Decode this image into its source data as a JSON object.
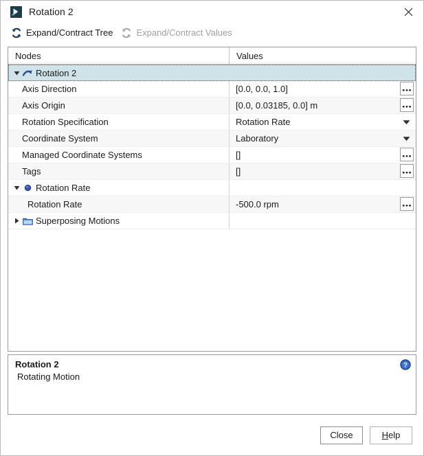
{
  "window": {
    "title": "Rotation 2",
    "icon": "rotation-app-icon",
    "close_icon": "close-icon"
  },
  "toolbar": {
    "items": [
      {
        "label": "Expand/Contract Tree",
        "icon": "refresh-icon",
        "enabled": true
      },
      {
        "label": "Expand/Contract Values",
        "icon": "refresh-icon",
        "enabled": false
      }
    ]
  },
  "table": {
    "columns": [
      "Nodes",
      "Values"
    ],
    "rows": [
      {
        "label": "Rotation 2",
        "value": "",
        "indent": 0,
        "twisty": "expanded",
        "icon": "rotation-arrow-icon",
        "selected": true,
        "shade": false,
        "control": "none"
      },
      {
        "label": "Axis Direction",
        "value": "[0.0, 0.0, 1.0]",
        "indent": 1,
        "twisty": "none",
        "icon": "none",
        "selected": false,
        "shade": false,
        "control": "ellipsis"
      },
      {
        "label": "Axis Origin",
        "value": "[0.0, 0.03185, 0.0] m",
        "indent": 1,
        "twisty": "none",
        "icon": "none",
        "selected": false,
        "shade": true,
        "control": "ellipsis"
      },
      {
        "label": "Rotation Specification",
        "value": "Rotation Rate",
        "indent": 1,
        "twisty": "none",
        "icon": "none",
        "selected": false,
        "shade": false,
        "control": "dropdown"
      },
      {
        "label": "Coordinate System",
        "value": "Laboratory",
        "indent": 1,
        "twisty": "none",
        "icon": "none",
        "selected": false,
        "shade": true,
        "control": "dropdown"
      },
      {
        "label": "Managed Coordinate Systems",
        "value": "[]",
        "indent": 1,
        "twisty": "none",
        "icon": "none",
        "selected": false,
        "shade": false,
        "control": "ellipsis"
      },
      {
        "label": "Tags",
        "value": "[]",
        "indent": 1,
        "twisty": "none",
        "icon": "none",
        "selected": false,
        "shade": true,
        "control": "ellipsis"
      },
      {
        "label": "Rotation Rate",
        "value": "",
        "indent": 0,
        "twisty": "expanded",
        "icon": "sphere-icon",
        "selected": false,
        "shade": false,
        "control": "none"
      },
      {
        "label": "Rotation Rate",
        "value": "-500.0 rpm",
        "indent": 2,
        "twisty": "none",
        "icon": "none",
        "selected": false,
        "shade": true,
        "control": "ellipsis"
      },
      {
        "label": "Superposing Motions",
        "value": "",
        "indent": 0,
        "twisty": "collapsed",
        "icon": "folder-icon",
        "selected": false,
        "shade": false,
        "control": "none"
      }
    ]
  },
  "description": {
    "title": "Rotation 2",
    "subtitle": "Rotating Motion",
    "help_icon": "help-circle-icon"
  },
  "footer": {
    "close_label": "Close",
    "help_label": "Help",
    "help_mnemonic": "H",
    "help_rest": "elp"
  },
  "colors": {
    "selection": "#cfe3e9",
    "row_shade": "#f7f7f7",
    "icon_blue": "#2b4b9e",
    "toolbar_icon": "#17365d",
    "toolbar_disabled": "#a0a0a0",
    "help_blue": "#2c5fb8"
  }
}
